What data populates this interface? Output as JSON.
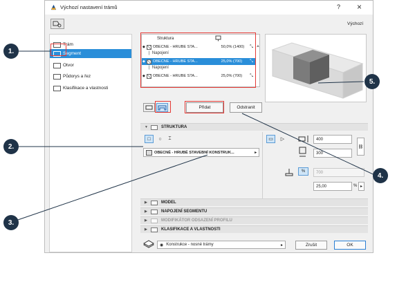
{
  "window": {
    "title": "Výchozí nastavení trámů",
    "help": "?",
    "close": "×",
    "defaults_label": "Výchozí"
  },
  "nav": {
    "items": [
      {
        "label": "Trám"
      },
      {
        "label": "Segment",
        "selected": true
      },
      {
        "label": "Otvor"
      },
      {
        "label": "Půdorys a řez"
      },
      {
        "label": "Klasifikace a vlastnosti"
      }
    ]
  },
  "structure_list": {
    "header": "Struktura",
    "rows": [
      {
        "name": "OBECNÉ - HRUBÉ STA...",
        "percent": "50,0% (1400)",
        "selected": false
      },
      {
        "name": "OBECNÉ - HRUBÉ STA...",
        "percent": "25,0% (700)",
        "selected": true
      },
      {
        "name": "OBECNÉ - HRUBÉ STA...",
        "percent": "25,0% (700)",
        "selected": false
      }
    ],
    "connection_label": "Napojení"
  },
  "actions": {
    "add": "Přidat",
    "remove": "Odstranit"
  },
  "structure_section": {
    "title": "STRUKTURA",
    "material": "OBECNÉ - HRUBÉ STAVEBNÍ KONSTRUK...",
    "width_value": "400",
    "height_value": "300",
    "dim_value": "700",
    "offset_value": "25,00",
    "offset_unit": "%"
  },
  "sections": [
    {
      "label": "MODEL",
      "dim": false
    },
    {
      "label": "NAPOJENÍ SEGMENTU",
      "dim": false
    },
    {
      "label": "MODIFIKÁTOR ODSAZENÍ PROFILU",
      "dim": true
    },
    {
      "label": "KLASIFIKACE A VLASTNOSTI",
      "dim": false
    }
  ],
  "footer": {
    "layer": "Konstrukce - nosné trámy",
    "cancel": "Zrušit",
    "ok": "OK"
  },
  "callouts": [
    "1.",
    "2.",
    "3.",
    "4.",
    "5."
  ],
  "colors": {
    "accent": "#2a8ed9",
    "callout": "#1f3348",
    "highlight": "#e53935"
  }
}
